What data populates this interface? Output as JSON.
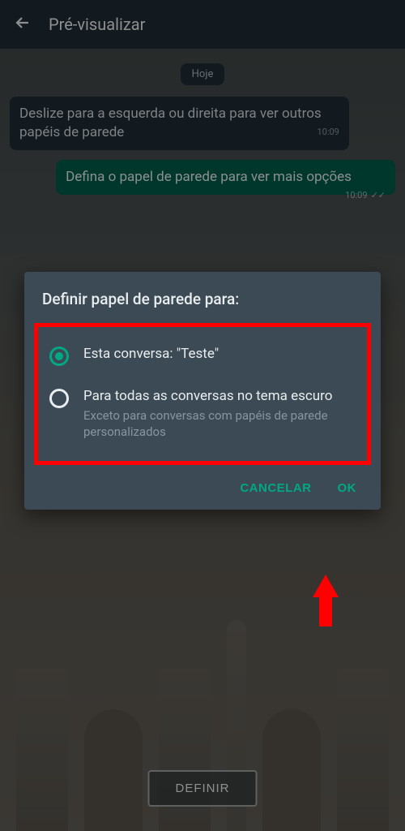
{
  "header": {
    "title": "Pré-visualizar"
  },
  "chat": {
    "date_label": "Hoje",
    "msg_in": {
      "text": "Deslize para a esquerda ou direita para ver outros papéis de parede",
      "time": "10:09"
    },
    "msg_out": {
      "text": "Defina o papel de parede para ver mais opções",
      "time": "10:09"
    }
  },
  "define_button": "DEFINIR",
  "dialog": {
    "title": "Definir papel de parede para:",
    "option1": {
      "label": "Esta conversa: \"Teste\""
    },
    "option2": {
      "label": "Para todas as conversas no tema escuro",
      "sub": "Exceto para conversas com papéis de parede personalizados"
    },
    "cancel": "CANCELAR",
    "ok": "OK"
  }
}
